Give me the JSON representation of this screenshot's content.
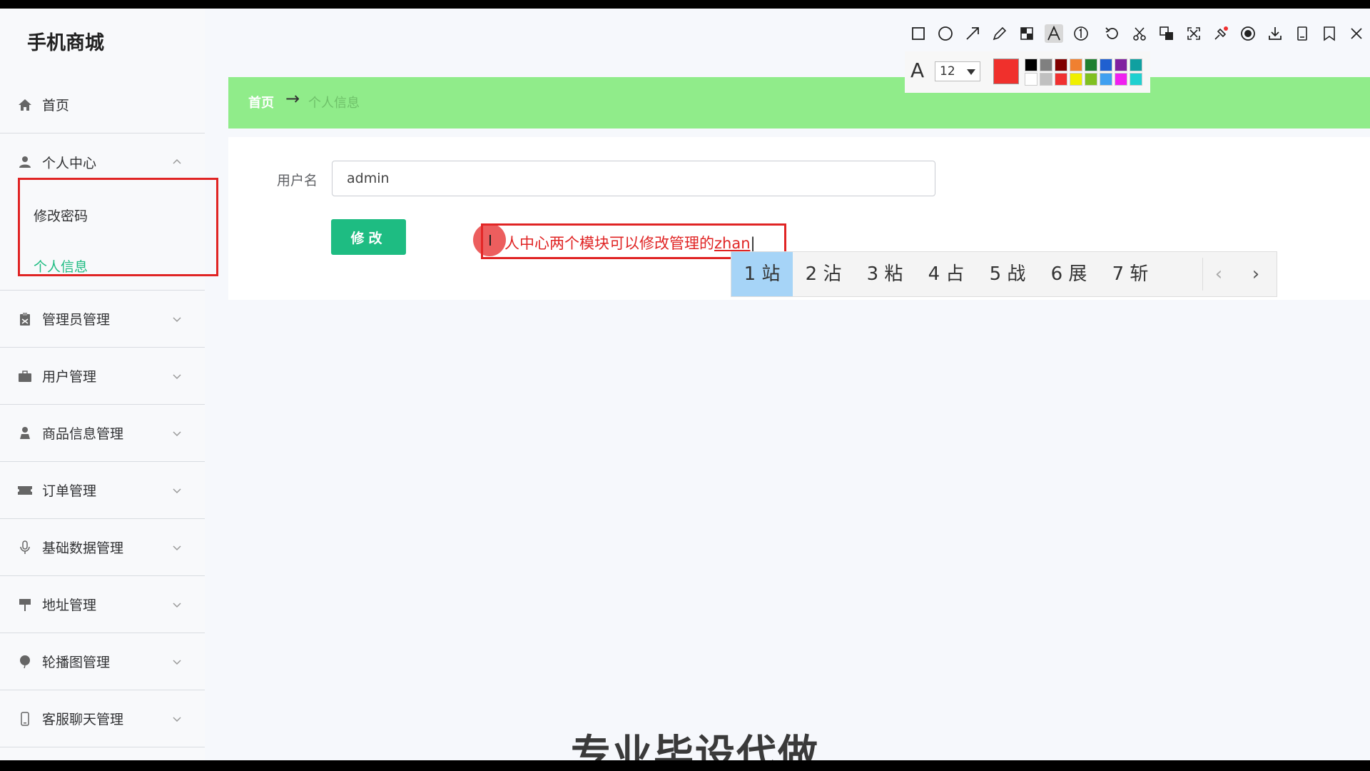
{
  "app": {
    "brand": "手机商城"
  },
  "sidebar": {
    "items": [
      {
        "label": "首页",
        "icon": "home-icon"
      },
      {
        "label": "个人中心",
        "icon": "user-icon",
        "expanded": true,
        "children": [
          {
            "label": "修改密码"
          },
          {
            "label": "个人信息",
            "active": true
          }
        ]
      },
      {
        "label": "管理员管理",
        "icon": "clipboard-icon"
      },
      {
        "label": "用户管理",
        "icon": "briefcase-icon"
      },
      {
        "label": "商品信息管理",
        "icon": "person-icon"
      },
      {
        "label": "订单管理",
        "icon": "ticket-icon"
      },
      {
        "label": "基础数据管理",
        "icon": "microphone-icon"
      },
      {
        "label": "地址管理",
        "icon": "signpost-icon"
      },
      {
        "label": "轮播图管理",
        "icon": "balloon-icon"
      },
      {
        "label": "客服聊天管理",
        "icon": "phone-icon"
      }
    ]
  },
  "breadcrumb": {
    "home": "首页",
    "arrow": "→",
    "current": "个人信息"
  },
  "form": {
    "username_label": "用户名",
    "username_value": "admin",
    "submit_label": "修改"
  },
  "annotation": {
    "text_main": "人中心两个模块可以修改管理的",
    "text_composing": "zhan"
  },
  "ime": {
    "candidates": [
      "1 站",
      "2 沾",
      "3 粘",
      "4 占",
      "5 战",
      "6 展",
      "7 斩"
    ],
    "prev": "‹",
    "next": "›"
  },
  "toolbar": {
    "font_size": "12",
    "current_color": "#f0302c",
    "palette_row1": [
      "#000000",
      "#808080",
      "#800000",
      "#f08030",
      "#208030",
      "#2060d0",
      "#8020a0",
      "#10a0a0"
    ],
    "palette_row2": [
      "#ffffff",
      "#c0c0c0",
      "#f03030",
      "#f0f000",
      "#80c020",
      "#40a0f0",
      "#f020f0",
      "#20d0d0"
    ]
  },
  "watermark": "专业毕设代做",
  "colors": {
    "accent": "#1ebc82",
    "breadcrumb_bg": "#90ec8a",
    "highlight": "#e02424"
  }
}
